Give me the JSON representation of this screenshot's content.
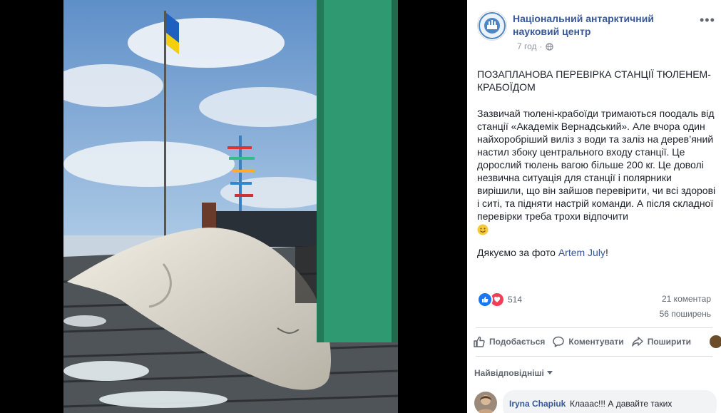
{
  "post": {
    "page_name": "Національний антарктичний науковий центр",
    "time": "7 год",
    "title": "ПОЗАПЛАНОВА ПЕРЕВІРКА СТАНЦІЇ ТЮЛЕНЕМ-КРАБОЇДОМ",
    "body": "Зазвичай тюлені-крабоїди тримаються поодаль від станції «Академік Вернадський». Але вчора один найхоробріший виліз з води та заліз на дерев’яний настил збоку центрального входу станції. Це дорослий тюлень вагою більше 200 кг. Це доволі незвична ситуація для станції і полярники вирішили, що він зайшов перевірити, чи всі здорові і ситі, та підняти настрій команди. А після складної перевірки треба трохи відпочити",
    "thanks_prefix": "Дякуємо за фото ",
    "thanks_name": "Artem July",
    "thanks_suffix": "!"
  },
  "stats": {
    "reactions_count": "514",
    "comments": "21 коментар",
    "shares": "56 поширень"
  },
  "actions": {
    "like": "Подобається",
    "comment": "Коментувати",
    "share": "Поширити"
  },
  "comments": {
    "sort_label": "Найвідповідніші",
    "first": {
      "author": "Iryna Chapiuk",
      "text": "Клааас!!! А давайте таких"
    }
  },
  "colors": {
    "link": "#385898",
    "like": "#1877f2",
    "love": "#f33e58"
  },
  "icons": {
    "options": "more-icon",
    "privacy": "globe-icon",
    "like": "thumbs-up-icon",
    "comment": "speech-bubble-icon",
    "share": "share-arrow-icon",
    "sort": "caret-down-icon",
    "emoji": "smile-emoji"
  }
}
